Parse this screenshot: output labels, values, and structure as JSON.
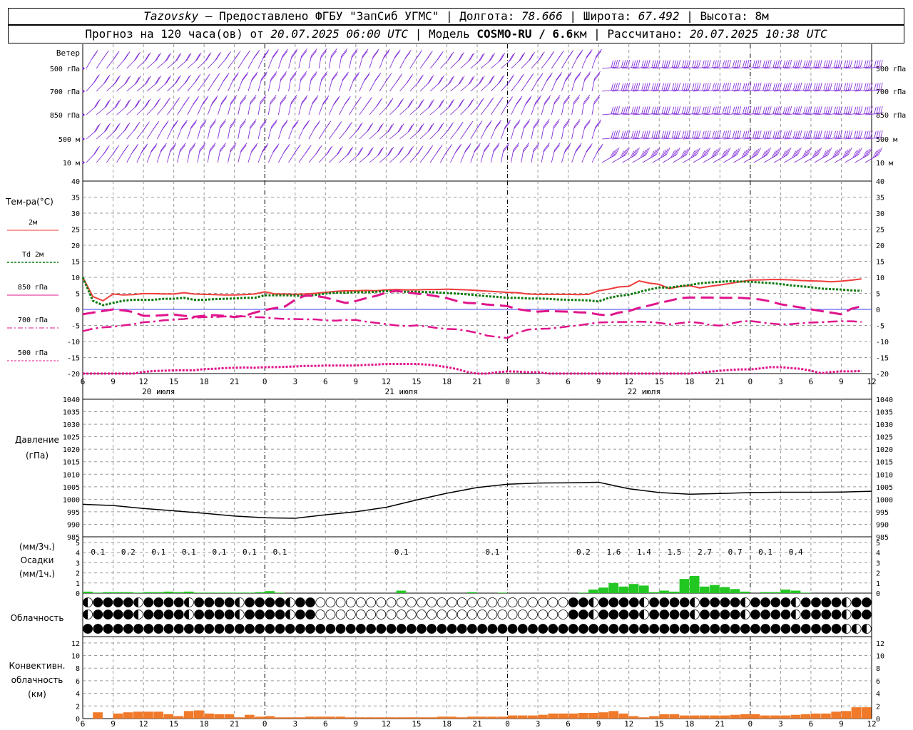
{
  "header": {
    "station": "Tazovsky",
    "source": " — Предоставлено ФГБУ \"ЗапСиб УГМС\" | Долгота: ",
    "lon": "78.666",
    "lat_label": " | Широта: ",
    "lat": "67.492",
    "alt_label": " | Высота: 8м",
    "forecast_prefix": "Прогноз на 120 часа(ов) от ",
    "forecast_start": "20.07.2025 06:00 UTC",
    "model_label": " | Модель ",
    "model": "COSMO-RU / 6.6",
    "model_unit": "км",
    "calc_label": " | Рассчитано: ",
    "calc_time": "20.07.2025 10:38 UTC"
  },
  "colors": {
    "grid": "#999999",
    "wind": "#7a1fd6",
    "t2m": "#f03a3a",
    "td2m": "#0d7a0d",
    "magenta": "#e0148c",
    "precip": "#22c722",
    "conv": "#f07a2a",
    "zero": "#3a3af0"
  },
  "wind_panel": {
    "title": "Ветер",
    "levels": [
      "500 гПа",
      "700 гПа",
      "850 гПа",
      "500 м",
      "10  м"
    ]
  },
  "temp_panel": {
    "title": "Тем-ра(°C)",
    "legend": [
      "2м",
      "Td  2м",
      "850 гПа",
      "700 гПа",
      "500 гПа"
    ],
    "ticks": [
      "40",
      "35",
      "30",
      "25",
      "20",
      "15",
      "10",
      "5",
      "0",
      "-5",
      "-10",
      "-15",
      "-20"
    ]
  },
  "pressure_panel": {
    "title1": "Давление",
    "title2": "(гПа)",
    "ticks": [
      "1040",
      "1035",
      "1030",
      "1025",
      "1020",
      "1015",
      "1010",
      "1005",
      "1000",
      "995",
      "990",
      "985"
    ]
  },
  "precip_panel": {
    "t1": "(мм/3ч.)",
    "t2": "Осадки",
    "t3": "(мм/1ч.)",
    "ticks": [
      "5",
      "4",
      "3",
      "2",
      "1",
      "0"
    ],
    "labels": [
      {
        "h": 1.5,
        "v": "0.1"
      },
      {
        "h": 4.5,
        "v": "0.2"
      },
      {
        "h": 7.5,
        "v": "0.1"
      },
      {
        "h": 10.5,
        "v": "0.1"
      },
      {
        "h": 13.5,
        "v": "0.1"
      },
      {
        "h": 16.5,
        "v": "0.1"
      },
      {
        "h": 19.5,
        "v": "0.1"
      },
      {
        "h": 31.5,
        "v": "0.1"
      },
      {
        "h": 40.5,
        "v": "0.1"
      },
      {
        "h": 49.5,
        "v": "0.2"
      },
      {
        "h": 52.5,
        "v": "1.6"
      },
      {
        "h": 55.5,
        "v": "1.4"
      },
      {
        "h": 58.5,
        "v": "1.5"
      },
      {
        "h": 61.5,
        "v": "2.7"
      },
      {
        "h": 64.5,
        "v": "0.7"
      },
      {
        "h": 67.5,
        "v": "0.1"
      },
      {
        "h": 70.5,
        "v": "0.4"
      }
    ]
  },
  "cloud_panel": {
    "title": "Облачность"
  },
  "conv_panel": {
    "t1": "Конвективн.",
    "t2": "облачность",
    "t3": "(км)",
    "ticks": [
      "12",
      "10",
      "8",
      "6",
      "4",
      "2",
      "0"
    ]
  },
  "time_axis": {
    "labels": [
      "6",
      "9",
      "12",
      "15",
      "18",
      "21",
      "0",
      "3",
      "6",
      "9",
      "12",
      "15",
      "18",
      "21",
      "0",
      "3",
      "6",
      "9",
      "12",
      "15",
      "18",
      "21",
      "0",
      "3",
      "6",
      "9",
      "12"
    ],
    "days": [
      {
        "h": 7.5,
        "label": "20 июля"
      },
      {
        "h": 31.5,
        "label": "21 июля"
      },
      {
        "h": 55.5,
        "label": "22 июля"
      }
    ],
    "midnights": [
      18,
      42,
      66
    ]
  },
  "chart_data": [
    {
      "type": "line",
      "title": "Тем-ра(°C)",
      "x_hours_from_start": [
        0,
        1,
        2,
        3,
        4,
        5,
        6,
        7,
        8,
        9,
        10,
        11,
        12,
        13,
        14,
        15,
        16,
        17,
        18,
        19,
        20,
        21,
        22,
        23,
        24,
        25,
        26,
        27,
        28,
        29,
        30,
        31,
        32,
        33,
        34,
        35,
        36,
        37,
        38,
        39,
        40,
        41,
        42,
        43,
        44,
        45,
        46,
        47,
        48,
        49,
        50,
        51,
        52,
        53,
        54,
        55,
        56,
        57,
        58,
        59,
        60,
        61,
        62,
        63,
        64,
        65,
        66,
        67,
        68,
        69,
        70,
        71,
        72,
        73,
        74,
        75,
        76,
        77
      ],
      "ylim": [
        -20,
        40
      ],
      "series": [
        {
          "name": "2м",
          "values": [
            10,
            4,
            2.7,
            4.8,
            4.5,
            4.6,
            4.9,
            4.9,
            4.8,
            4.8,
            5.2,
            4.8,
            4.7,
            4.6,
            4.5,
            4.5,
            4.6,
            4.8,
            5.5,
            4.8,
            4.8,
            4.7,
            4.8,
            5,
            5.3,
            5.6,
            5.8,
            5.8,
            5.9,
            5.8,
            6.1,
            6.2,
            6.1,
            6.1,
            6.2,
            6.2,
            6.3,
            6.2,
            6.1,
            5.9,
            5.7,
            5.5,
            5.3,
            5.2,
            4.8,
            4.7,
            4.7,
            4.7,
            4.7,
            4.6,
            4.7,
            5.8,
            6.3,
            7,
            7.2,
            8.9,
            8.2,
            7.8,
            6.5,
            7.1,
            7.4,
            6.7,
            7.2,
            7.6,
            8.1,
            8.6,
            9.1,
            9.2,
            9.3,
            9.3,
            9.2,
            9,
            8.9,
            8.8,
            8.6,
            8.8,
            9.1,
            9.5
          ]
        },
        {
          "name": "Td 2м",
          "values": [
            10,
            2.7,
            1.3,
            2,
            2.7,
            3,
            3,
            3,
            3.3,
            3.3,
            3.6,
            3,
            3,
            3.2,
            3.3,
            3.4,
            3.6,
            3.6,
            4.4,
            4.4,
            4.4,
            4.3,
            4.2,
            4.5,
            4.9,
            5.2,
            5.2,
            5.4,
            5.3,
            5.5,
            5.7,
            5.6,
            5.5,
            5.5,
            5.4,
            5.3,
            5.1,
            4.9,
            4.7,
            4.4,
            4.1,
            3.9,
            3.6,
            3.6,
            3.4,
            3.4,
            3.3,
            3.1,
            3,
            2.9,
            2.8,
            2.5,
            3.6,
            4.2,
            4.6,
            5.4,
            6.2,
            6.8,
            6.8,
            7.2,
            7.6,
            8.1,
            8.4,
            8.6,
            8.8,
            8.7,
            8.6,
            8.4,
            8.2,
            7.9,
            7.5,
            7.2,
            6.9,
            6.5,
            6.3,
            6.2,
            5.9,
            5.8
          ]
        },
        {
          "name": "850 гПа",
          "values": [
            -1.5,
            -1,
            -0.5,
            0,
            -0.3,
            -0.8,
            -2,
            -2,
            -1.8,
            -1.6,
            -2,
            -2.3,
            -2,
            -1.8,
            -2,
            -2.4,
            -2,
            -1,
            -0.2,
            0.4,
            0.9,
            3,
            4.3,
            4.2,
            3.7,
            2.8,
            2,
            2.6,
            3.5,
            4.2,
            5.2,
            5.8,
            5.3,
            4.9,
            4.6,
            4.1,
            3.5,
            2.6,
            2,
            1.9,
            1.5,
            1.3,
            1,
            0.1,
            -0.4,
            -0.7,
            -0.5,
            -0.6,
            -0.7,
            -0.9,
            -1,
            -1.6,
            -1.9,
            -1,
            -0.5,
            0.5,
            1.2,
            2,
            2.7,
            3.5,
            3.7,
            3.7,
            3.7,
            3.6,
            3.6,
            3.6,
            3.4,
            3.1,
            2.5,
            1.6,
            1.1,
            0.6,
            0,
            -0.5,
            -1,
            -1.5,
            0.2,
            1
          ]
        },
        {
          "name": "700 гПа",
          "values": [
            -6.8,
            -6,
            -5.6,
            -5.4,
            -5,
            -4.6,
            -4,
            -3.8,
            -3.4,
            -3.2,
            -3,
            -2.6,
            -2.4,
            -2.4,
            -2.2,
            -2.1,
            -2.2,
            -2.4,
            -2.5,
            -2.8,
            -3,
            -3,
            -3.1,
            -3.1,
            -3.4,
            -3.5,
            -3.3,
            -3.3,
            -3.8,
            -4.2,
            -4.6,
            -5,
            -5.2,
            -5,
            -5.3,
            -5.8,
            -6.1,
            -6.2,
            -6.7,
            -7.3,
            -8.2,
            -8.6,
            -8.9,
            -7.3,
            -6.3,
            -6.1,
            -6,
            -5.7,
            -5.3,
            -5,
            -4.5,
            -4.1,
            -4,
            -3.9,
            -3.9,
            -3.8,
            -3.9,
            -4.2,
            -4.7,
            -4.3,
            -3.9,
            -4.2,
            -4.8,
            -5.1,
            -4.5,
            -3.8,
            -3.6,
            -4,
            -4.4,
            -4.7,
            -4.6,
            -4.3,
            -4.1,
            -4,
            -3.8,
            -3.7,
            -3.7,
            -3.9
          ]
        },
        {
          "name": "500 гПа",
          "values": [
            -21,
            -21,
            -21,
            -21,
            -21,
            -20,
            -19.5,
            -19.2,
            -19.1,
            -19,
            -19,
            -19,
            -18.6,
            -18.5,
            -18.3,
            -18.2,
            -18.1,
            -18.2,
            -18,
            -18,
            -17.9,
            -17.8,
            -17.6,
            -17.6,
            -17.5,
            -17.5,
            -17.5,
            -17.5,
            -17.3,
            -17.2,
            -17,
            -17,
            -17,
            -17,
            -17.2,
            -17.5,
            -18,
            -18.6,
            -19.5,
            -20.4,
            -20.8,
            -19.6,
            -19.3,
            -19.4,
            -19.6,
            -19.6,
            -20,
            -20.7,
            -21,
            -21,
            -21,
            -21,
            -21,
            -21,
            -21,
            -21,
            -21,
            -21,
            -21,
            -20.5,
            -20,
            -19.8,
            -19.4,
            -19.1,
            -18.9,
            -18.7,
            -18.7,
            -18.4,
            -18,
            -18,
            -18.3,
            -18.5,
            -19.1,
            -19.9,
            -19.5,
            -19.3,
            -19.3,
            -19.2
          ]
        }
      ]
    },
    {
      "type": "line",
      "title": "Давление (гПа)",
      "ylim": [
        985,
        1040
      ],
      "x_hours_from_start": [
        0,
        3,
        6,
        9,
        12,
        15,
        18,
        21,
        24,
        27,
        30,
        33,
        36,
        39,
        42,
        45,
        48,
        51,
        54,
        57,
        60,
        63,
        66,
        69,
        72,
        75,
        78
      ],
      "series": [
        {
          "name": "Давление",
          "values": [
            998,
            997.5,
            996.3,
            995.4,
            994.4,
            993.3,
            992.6,
            992.4,
            993.8,
            995,
            996.8,
            999.7,
            1002.4,
            1004.7,
            1006,
            1006.5,
            1006.6,
            1006.8,
            1004.2,
            1002.7,
            1002,
            1002.3,
            1002.7,
            1002.8,
            1002.8,
            1002.9,
            1003.2
          ]
        }
      ]
    },
    {
      "type": "bar",
      "title": "Осадки (мм/1ч.)",
      "ylim": [
        0,
        5
      ],
      "x_hours_from_start": [
        0,
        1,
        2,
        3,
        4,
        5,
        6,
        7,
        8,
        9,
        10,
        11,
        12,
        13,
        14,
        15,
        16,
        17,
        18,
        19,
        20,
        21,
        22,
        23,
        24,
        25,
        26,
        27,
        28,
        29,
        30,
        31,
        32,
        33,
        34,
        35,
        36,
        37,
        38,
        39,
        40,
        41,
        42,
        43,
        44,
        45,
        46,
        47,
        48,
        49,
        50,
        51,
        52,
        53,
        54,
        55,
        56,
        57,
        58,
        59,
        60,
        61,
        62,
        63,
        64,
        65,
        66,
        67,
        68,
        69,
        70,
        71,
        72,
        73,
        74,
        75,
        76,
        77
      ],
      "series": [
        {
          "name": "мм/1ч.",
          "values": [
            0.15,
            0.05,
            0.1,
            0.1,
            0.1,
            0.05,
            0.1,
            0.1,
            0.15,
            0.1,
            0.15,
            0.05,
            0.05,
            0.05,
            0.05,
            0.05,
            0.05,
            0.1,
            0.2,
            0.05,
            0,
            0,
            0,
            0,
            0,
            0,
            0,
            0,
            0,
            0,
            0,
            0.25,
            0,
            0,
            0,
            0,
            0,
            0,
            0.1,
            0,
            0,
            0.05,
            0,
            0,
            0,
            0,
            0,
            0,
            0,
            0.05,
            0.35,
            0.55,
            1,
            0.65,
            0.9,
            0.75,
            0.1,
            0.25,
            0.15,
            1.4,
            1.7,
            0.65,
            0.8,
            0.6,
            0.4,
            0.15,
            0,
            0.1,
            0.1,
            0.35,
            0.25,
            0.05,
            0,
            0,
            0,
            0,
            0,
            0
          ]
        }
      ]
    },
    {
      "type": "bar",
      "title": "Конвективн. облачность (км)",
      "ylim": [
        0,
        13
      ],
      "x_hours_from_start": [
        0,
        1,
        2,
        3,
        4,
        5,
        6,
        7,
        8,
        9,
        10,
        11,
        12,
        13,
        14,
        15,
        16,
        17,
        18,
        19,
        20,
        21,
        22,
        23,
        24,
        25,
        26,
        27,
        28,
        29,
        30,
        31,
        32,
        33,
        34,
        35,
        36,
        37,
        38,
        39,
        40,
        41,
        42,
        43,
        44,
        45,
        46,
        47,
        48,
        49,
        50,
        51,
        52,
        53,
        54,
        55,
        56,
        57,
        58,
        59,
        60,
        61,
        62,
        63,
        64,
        65,
        66,
        67,
        68,
        69,
        70,
        71,
        72,
        73,
        74,
        75,
        76,
        77
      ],
      "series": [
        {
          "name": "км",
          "values": [
            0,
            1,
            0,
            0.8,
            1,
            1.1,
            1.1,
            1.1,
            0.7,
            0.4,
            1.2,
            1.3,
            0.8,
            0.7,
            0.7,
            0.2,
            0.6,
            0.3,
            0.4,
            0.2,
            0.2,
            0.2,
            0.3,
            0.3,
            0.3,
            0.3,
            0.2,
            0.2,
            0.2,
            0.2,
            0.2,
            0.2,
            0.2,
            0.2,
            0.2,
            0.3,
            0.3,
            0.2,
            0.3,
            0.3,
            0.3,
            0.3,
            0.5,
            0.5,
            0.5,
            0.6,
            0.8,
            0.8,
            0.8,
            0.9,
            0.9,
            1,
            1.2,
            0.8,
            0.4,
            0.2,
            0.4,
            0.7,
            0.7,
            0.5,
            0.5,
            0.5,
            0.5,
            0.5,
            0.6,
            0.7,
            0.7,
            0.5,
            0.5,
            0.5,
            0.6,
            0.7,
            0.8,
            0.8,
            1.1,
            1.2,
            1.8,
            1.8,
            0
          ]
        }
      ]
    }
  ]
}
